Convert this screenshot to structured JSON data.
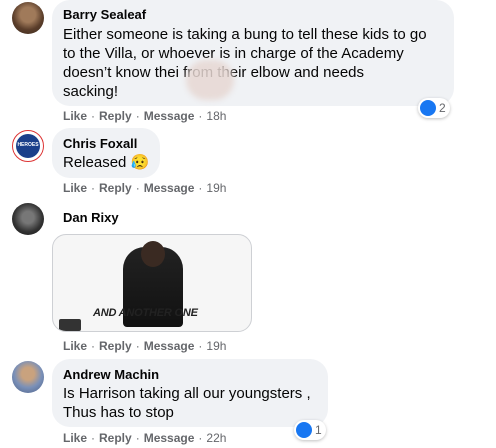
{
  "comments": [
    {
      "author": "Barry Sealeaf",
      "text": "Either someone is taking a bung to tell these kids to go\nto the Villa, or whoever is in charge of the Academy\ndoesn’t know thei          from their elbow and needs\nsacking!",
      "actions": {
        "like": "Like",
        "reply": "Reply",
        "message": "Message",
        "time": "18h"
      },
      "reactions": {
        "icon": "like-icon",
        "count": "2"
      }
    },
    {
      "author": "Chris Foxall",
      "text": "Released 😥",
      "avatar_text": "HEROES",
      "actions": {
        "like": "Like",
        "reply": "Reply",
        "message": "Message",
        "time": "19h"
      }
    },
    {
      "author": "Dan Rixy",
      "gif_caption": "AND ANOTHER ONE",
      "actions": {
        "like": "Like",
        "reply": "Reply",
        "message": "Message",
        "time": "19h"
      }
    },
    {
      "author": "Andrew Machin",
      "text": "Is Harrison taking all our youngsters ,\nThus has to stop",
      "actions": {
        "like": "Like",
        "reply": "Reply",
        "message": "Message",
        "time": "22h"
      },
      "reactions": {
        "icon": "like-icon",
        "count": "1"
      }
    }
  ],
  "colors": {
    "bubble": "#f0f2f5",
    "like_blue": "#1877f2",
    "meta_gray": "#65676b"
  }
}
